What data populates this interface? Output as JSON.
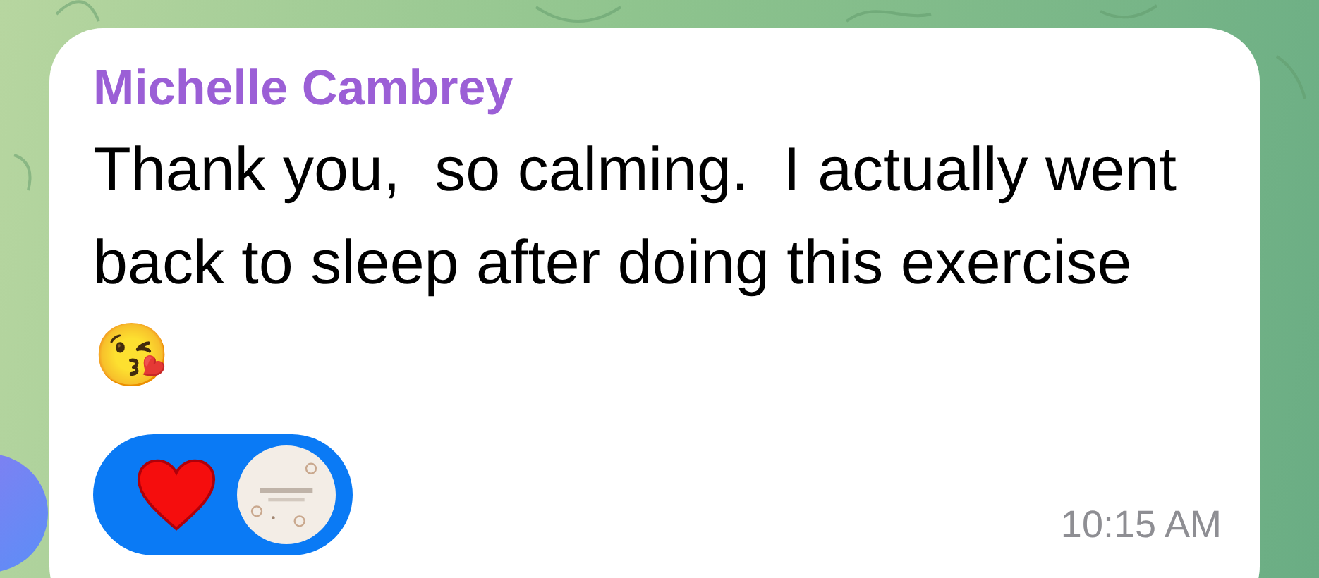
{
  "message": {
    "sender": "Michelle Cambrey",
    "text": "Thank you,  so calming.  I actually went back to sleep after doing this exercise 😘",
    "time": "10:15 AM",
    "reactions": [
      {
        "kind": "heart",
        "selected": true
      }
    ]
  }
}
